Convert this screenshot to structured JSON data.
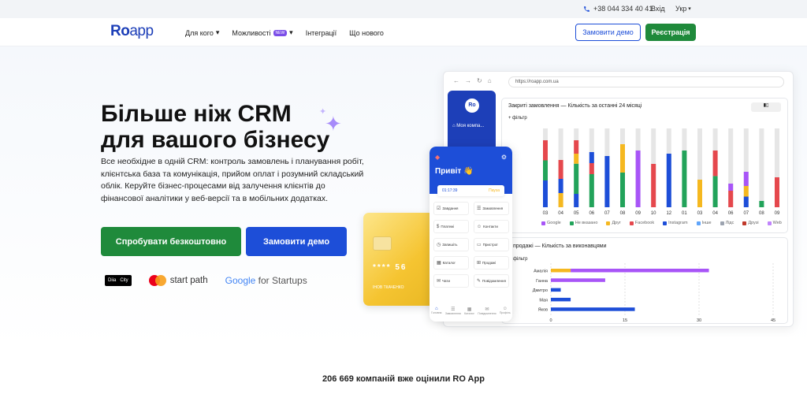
{
  "topbar": {
    "phone": "+38 044 334 40 41",
    "login": "Вхід",
    "lang": "Укр"
  },
  "header": {
    "logo_ro": "Ro",
    "logo_app": "app",
    "nav": [
      {
        "label": "Для кого",
        "has_arrow": true
      },
      {
        "label": "Можливості",
        "badge": "NEW",
        "has_arrow": true
      },
      {
        "label": "Інтеграції"
      },
      {
        "label": "Що нового"
      }
    ],
    "order_demo": "Замовити демо",
    "register": "Реєстрація"
  },
  "hero": {
    "title_line1": "Більше ніж CRM",
    "title_line2": "для вашого бізнесу",
    "description": "Все необхідне в одній CRM: контроль замовлень і планування робіт, клієнтська база та комунікація, прийом оплат і розумний складський облік. Керуйте бізнес-процесами від залучення клієнтів до фінансової аналітики у веб-версії та в мобільних додатках.",
    "try_free": "Спробувати безкоштовно",
    "order_demo": "Замовити демо"
  },
  "partners": {
    "diia_1": "Diia",
    "diia_2": "City",
    "startpath": "start path",
    "google": "Google",
    "startups": " for Startups"
  },
  "mockup": {
    "url": "https://roapp.com.ua",
    "sidebar_logo": "Ro",
    "sidebar_company": "Моя компа...",
    "chart1_title": "Закриті замовлення  —  Кількість за останні 24 місяці",
    "chart1_filter": "+ фільтр",
    "chart2_title": "продажі  —  Кількість за виконавцями",
    "chart2_filter": "фільтр",
    "phone_greeting": "Привіт 👋",
    "phone_time": "01:17:39",
    "phone_pause": "Пауза",
    "phone_tiles": [
      "Завдання",
      "Замовлення",
      "Платежі",
      "Контакти",
      "Запишіть",
      "Пристрої",
      "Каталог",
      "Продажі",
      "Чати",
      "Повідомлення"
    ],
    "phone_nav": [
      "Головна",
      "Замовлення",
      "Каталог",
      "Повідомлення",
      "Профіль"
    ],
    "card_number": "**** 56",
    "card_name": "ІНОВ ТКАЧЕНКО"
  },
  "chart_data": [
    {
      "type": "bar",
      "title": "Закриті замовлення — Кількість за останні 24 місяці",
      "categories": [
        "03",
        "04",
        "05",
        "06",
        "07",
        "08",
        "09",
        "10",
        "12",
        "01",
        "03",
        "04",
        "06",
        "07",
        "08",
        "09"
      ],
      "legend": [
        "Google",
        "Не вказано",
        "Друг",
        "Facebook",
        "Instagram",
        "Інше",
        "Лідс",
        "Друзі",
        "Web"
      ],
      "colors": {
        "Google": "#a855f7",
        "Не вказано": "#22a35a",
        "Друг": "#f5b820",
        "Facebook": "#e5484d",
        "Instagram": "#1d4ed8",
        "Інше": "#60a5fa",
        "Лідс": "#9ca3af",
        "Друзі": "#c0392b",
        "Web": "#c084fc"
      },
      "series_main": [
        "Instagram",
        "Не вказано",
        "Facebook",
        "Друг",
        "Google"
      ],
      "bars": [
        {
          "Instagram": 0.4,
          "Не вказано": 0.3,
          "Facebook": 0.3
        },
        {
          "Друг": 0.3,
          "Instagram": 0.3,
          "Facebook": 0.4
        },
        {
          "Instagram": 0.2,
          "Не вказано": 0.45,
          "Друг": 0.15,
          "Facebook": 0.2
        },
        {
          "Не вказано": 0.6,
          "Facebook": 0.2,
          "Instagram": 0.2
        },
        {
          "Instagram": 1.0
        },
        {
          "Не вказано": 0.55,
          "Друг": 0.45
        },
        {
          "Google": 1.0
        },
        {
          "Facebook": 1.0
        },
        {
          "Instagram": 1.0
        },
        {
          "Не вказано": 1.0
        },
        {
          "Друг": 1.0
        },
        {
          "Не вказано": 0.55,
          "Facebook": 0.45
        },
        {
          "Facebook": 0.7,
          "Google": 0.3
        },
        {
          "Instagram": 0.3,
          "Друг": 0.3,
          "Google": 0.4
        },
        {
          "Не вказано": 1.0
        },
        {
          "Facebook": 1.0
        }
      ],
      "heights": [
        0.85,
        0.6,
        0.85,
        0.7,
        0.65,
        0.8,
        0.72,
        0.55,
        0.68,
        0.72,
        0.35,
        0.72,
        0.3,
        0.45,
        0.08,
        0.38
      ]
    },
    {
      "type": "bar",
      "orientation": "horizontal",
      "title": "продажі — Кількість за виконавцями",
      "categories": [
        "Амалія",
        "Ганна",
        "Дмитро",
        "Мая",
        "Яков"
      ],
      "xlim": [
        0,
        45
      ],
      "xticks": [
        0,
        15,
        30,
        45
      ],
      "series": [
        {
          "name": "Друг",
          "color": "#f5b820",
          "values": [
            4,
            0,
            0,
            0,
            0
          ]
        },
        {
          "name": "Google",
          "color": "#a855f7",
          "values": [
            28,
            11,
            0,
            0,
            0
          ]
        },
        {
          "name": "Instagram",
          "color": "#1d4ed8",
          "values": [
            0,
            0,
            2,
            4,
            17
          ]
        }
      ]
    }
  ],
  "stats": {
    "text": "206 669 компаній вже оцінили RO App"
  }
}
